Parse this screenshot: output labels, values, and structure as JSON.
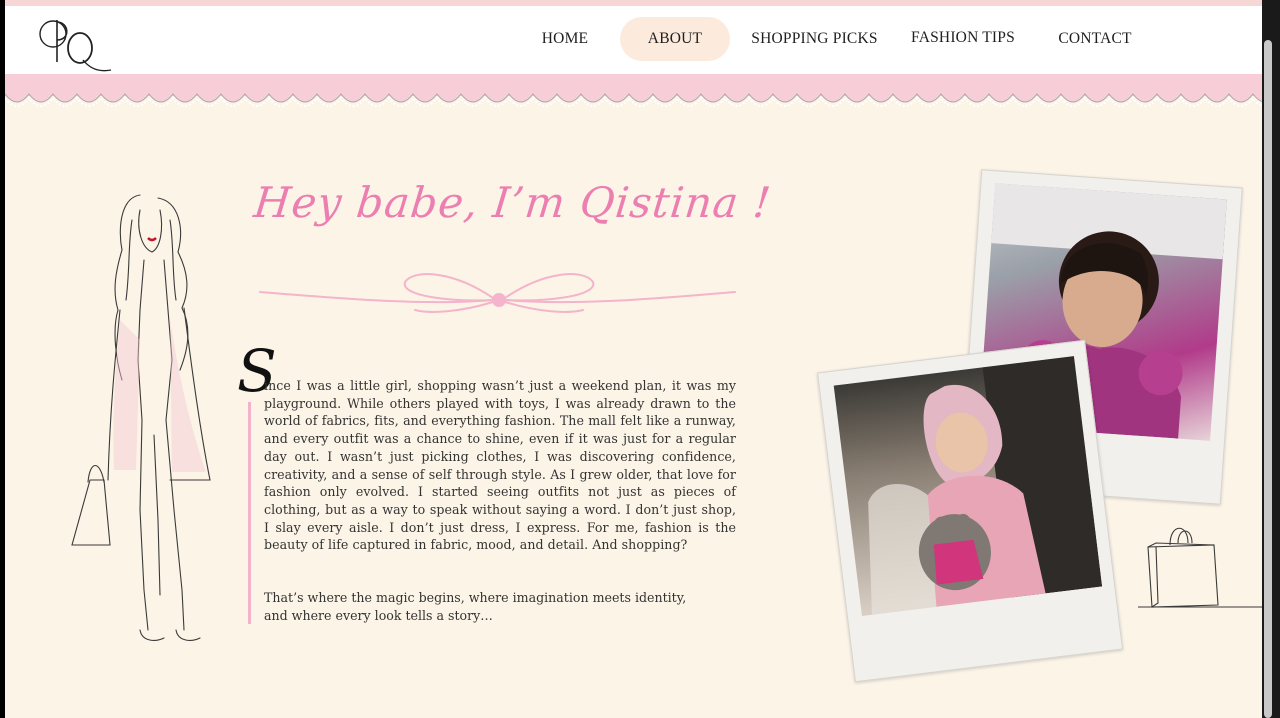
{
  "logo": {
    "text": "PQ"
  },
  "nav": {
    "items": [
      {
        "label": "HOME",
        "active": false
      },
      {
        "label": "ABOUT",
        "active": true
      },
      {
        "label": "SHOPPING PICKS",
        "active": false
      },
      {
        "label": "FASHION TIPS",
        "active": false
      },
      {
        "label": "CONTACT",
        "active": false
      }
    ]
  },
  "about": {
    "heading": "Hey babe, I’m Qistina !",
    "drop_cap": "S",
    "paragraph_1": "ince I was a little girl, shopping wasn’t just a weekend plan, it was my playground. While others played with toys, I was already drawn to the world of fabrics, fits, and everything fashion. The mall felt like a runway, and every outfit was a chance to shine, even if it was just for a regular day out. I wasn’t just picking clothes, I was discovering confidence, creativity, and a sense of self through style. As I grew older, that love for fashion only evolved. I started seeing outfits not just as pieces of clothing, but as a way to speak without saying a word. I don’t just shop, I slay every aisle. I don’t just dress, I express. For me, fashion is the beauty of life captured in fabric, mood, and detail. And shopping?",
    "paragraph_2_line_1": "That’s where the magic begins, where imagination meets identity,",
    "paragraph_2_line_2": "and where every look tells a story…"
  },
  "colors": {
    "background": "#fcf4e7",
    "accent_pink": "#ec7fb1",
    "scallop_pink": "#f7cdd8",
    "nav_active": "#fcebdc"
  },
  "icons": [
    "fashion-sketch-illustration",
    "bow-ribbon-divider",
    "shopping-bag-icon",
    "logo-monogram"
  ]
}
